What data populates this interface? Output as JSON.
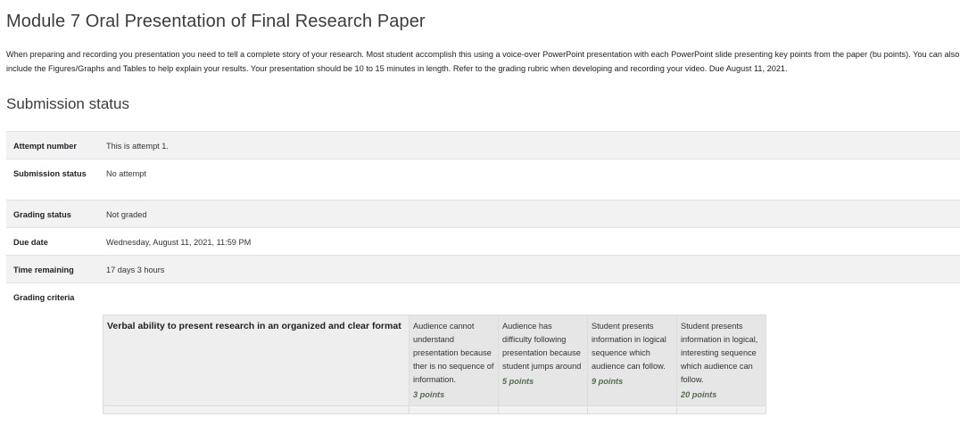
{
  "assignment": {
    "title": "Module 7 Oral Presentation of Final Research Paper",
    "description": "When preparing and recording you presentation you need to tell a complete story of your research. Most student accomplish this using a voice-over PowerPoint presentation with each PowerPoint slide presenting key points from the paper (bu points). You can also include the Figures/Graphs and Tables to help explain your results. Your presentation should be 10 to 15 minutes in length. Refer to the grading rubric when developing and recording your video. Due August 11, 2021."
  },
  "submission_status": {
    "heading": "Submission status",
    "rows": [
      {
        "label": "Attempt number",
        "value": "This is attempt 1."
      },
      {
        "label": "Submission status",
        "value": "No attempt"
      },
      {
        "label": "Grading status",
        "value": "Not graded"
      },
      {
        "label": "Due date",
        "value": "Wednesday, August 11, 2021, 11:59 PM"
      },
      {
        "label": "Time remaining",
        "value": "17 days 3 hours"
      },
      {
        "label": "Grading criteria",
        "value": ""
      }
    ]
  },
  "rubric": {
    "criteria": [
      {
        "description": "Verbal ability to present research in an organized and clear format",
        "levels": [
          {
            "definition": "Audience cannot understand presentation because ther is no sequence of information.",
            "score": "3 points"
          },
          {
            "definition": "Audience has difficulty following presentation because student jumps around",
            "score": "5 points"
          },
          {
            "definition": "Student presents information in logical sequence which audience can follow.",
            "score": "9 points"
          },
          {
            "definition": "Student presents information in logical, interesting sequence which audience can follow.",
            "score": "20 points"
          }
        ]
      }
    ]
  }
}
